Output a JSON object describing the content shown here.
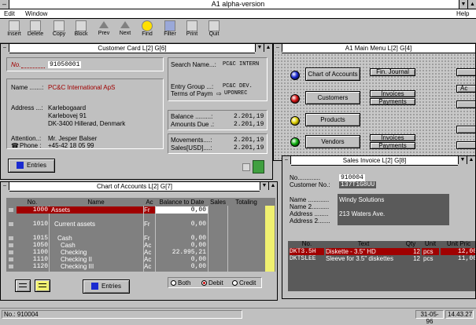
{
  "app": {
    "title": "A1 alpha-version"
  },
  "menu": {
    "edit": "Edit",
    "window": "Window",
    "help": "Help"
  },
  "toolbar": {
    "insert": "Insert",
    "delete": "Delete",
    "copy": "Copy",
    "block": "Block",
    "prev": "Prev",
    "next": "Next",
    "find": "Find",
    "filter": "Filter",
    "print": "Print",
    "quit": "Quit"
  },
  "customer_card": {
    "title": "Customer Card L[2] G[6]",
    "no_label": "No.",
    "no_value": "91050001",
    "name_label": "Name .......:",
    "name_value": "PC&C International ApS",
    "address_label": "Address ...:",
    "address_lines": [
      "Karlebogaard",
      "Karlebovej 91",
      "DK-3400 Hillerød, Denmark"
    ],
    "attention_label": "Attention..:",
    "attention_value": "Mr. Jesper Balser",
    "phone_label": "Phone :",
    "phone_value": "+45-42 18 05 99",
    "search_label": "Search Name...:",
    "search_value": "PC&C INTERN",
    "entry_group_label": "Entry Group ...:",
    "entry_group_value": "PC&C DEV.",
    "terms_label": "Terms of Paym",
    "terms_value": "UPONREC",
    "balance_label": "Balance .........:",
    "balance_value": "2.201,19",
    "amounts_due_label": "Amounts Due .:",
    "amounts_due_value": "2.201,19",
    "movements_label": "Movements....:",
    "movements_value": "2.201,19",
    "sales_label": "Sales[USD]....:",
    "sales_value": "2.201,19",
    "entries_button": "Entries"
  },
  "chart_of_accounts": {
    "title": "Chart of Accounts L[2] G[7]",
    "columns": {
      "no": "No.",
      "name": "Name",
      "ac": "Ac",
      "balance": "Balance to Date",
      "sales": "Sales",
      "totaling": "Totaling"
    },
    "rows": [
      {
        "no": "1000",
        "name": "Assets",
        "ac": "Fr",
        "balance": "0,00"
      },
      {
        "no": "1010",
        "name": "Current assets",
        "ac": "Fr",
        "balance": "0,00"
      },
      {
        "no": "1015",
        "name": "Cash",
        "ac": "Fr",
        "balance": "0,00"
      },
      {
        "no": "1050",
        "name": "Cash",
        "ac": "Ac",
        "balance": "0,00"
      },
      {
        "no": "1100",
        "name": "Checking",
        "ac": "Ac",
        "balance": "22.995,21"
      },
      {
        "no": "1110",
        "name": "Checking II",
        "ac": "Ac",
        "balance": "0,00"
      },
      {
        "no": "1120",
        "name": "Checking III",
        "ac": "Ac",
        "balance": "0,00"
      }
    ],
    "entries_button": "Entries",
    "filter_both": "Both",
    "filter_debit": "Debit",
    "filter_credit": "Credit"
  },
  "main_menu": {
    "title": "A1 Main Menu L[2] G[4]",
    "items": [
      {
        "label": "Chart of Accounts",
        "color": "#1a2ad0"
      },
      {
        "label": "Customers",
        "color": "#d01010"
      },
      {
        "label": "Products",
        "color": "#e0d000"
      },
      {
        "label": "Vendors",
        "color": "#10b010"
      }
    ],
    "fin_journal": "Fin. Journal",
    "invoices": "Invoices",
    "payments": "Payments",
    "right_a": "Ac"
  },
  "sales_invoice": {
    "title": "Sales Invoice L[2] G[8]",
    "no_label": "No.............",
    "no_value": "910004",
    "customer_label": "Customer No.:",
    "customer_value": "137T1G8UU",
    "name_label": "Name ............",
    "name_value": "Windy Solutions",
    "name2_label": "Name 2..........",
    "address_label": "Address ........",
    "address_value": "213 Waters Ave.",
    "address2_label": "Address 2.......",
    "columns": {
      "no": "No.",
      "text": "Text",
      "qty": "Qty",
      "unit": "Unit",
      "unit_price": "Unit Pric"
    },
    "lines": [
      {
        "no": "DKT3.5H",
        "text": "Diskette - 3.5\" HD",
        "qty": "12",
        "unit": "pcs",
        "price": "12,00"
      },
      {
        "no": "DKTSLEE",
        "text": "Sleeve for 3.5\" diskettes",
        "qty": "12",
        "unit": "pcs",
        "price": "11,00"
      }
    ]
  },
  "status": {
    "record": "No.: 910004",
    "date": "31-05-96",
    "time": "14.43.27"
  },
  "colors": {
    "accent_red": "#a00000",
    "totaling_yellow": "#f0f070"
  }
}
